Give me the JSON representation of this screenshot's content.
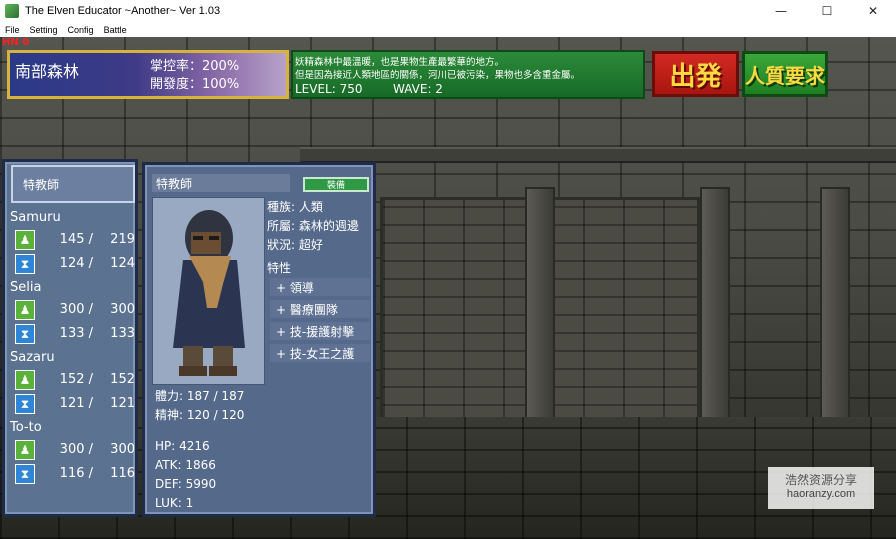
{
  "window": {
    "title": "The Elven Educator ~Another~ Ver 1.03",
    "minimize": "—",
    "maximize": "☐",
    "close": "✕"
  },
  "menu": [
    "File",
    "Setting",
    "Config",
    "Battle"
  ],
  "hud": {
    "corner_text": "HN 0"
  },
  "area": {
    "name": "南部森林",
    "control_label": "掌控率：200%",
    "development_label": "開發度：100%"
  },
  "description": {
    "line1": "妖精森林中最溫暖，也是果物生產最繁華的地方。",
    "line2": "但是因為接近人類地區的關係，河川已被污染，果物也多含重金屬。",
    "level": "LEVEL: 750",
    "wave": "WAVE: 2"
  },
  "buttons": {
    "depart": "出発",
    "hostage_request": "人質要求",
    "equip": "裝備"
  },
  "party": {
    "tab_label": "特教師",
    "members": [
      {
        "name": "Samuru",
        "hp": "145 /",
        "hp_max": "219",
        "mp": "124 /",
        "mp_max": "124"
      },
      {
        "name": "Selia",
        "hp": "300 /",
        "hp_max": "300",
        "mp": "133 /",
        "mp_max": "133"
      },
      {
        "name": "Sazaru",
        "hp": "152 /",
        "hp_max": "152",
        "mp": "121 /",
        "mp_max": "121"
      },
      {
        "name": "To-to",
        "hp": "300 /",
        "hp_max": "300",
        "mp": "116 /",
        "mp_max": "116"
      }
    ]
  },
  "detail": {
    "name": "特教師",
    "race": "種族: 人類",
    "affiliation": "所屬: 森林的週邊",
    "status": "狀況: 超好",
    "traits_label": "特性",
    "traits": [
      "+ 領導",
      "+ 醫療團隊",
      "+ 技-援護射擊",
      "+ 技-女王之護"
    ],
    "stamina": "體力: 187 / 187",
    "spirit": "精神: 120 / 120",
    "hp": "HP: 4216",
    "atk": "ATK: 1866",
    "def": "DEF: 5990",
    "luk": "LUK: 1"
  },
  "watermark": {
    "cn": "浩然资源分享",
    "url": "haoranzy.com"
  },
  "colors": {
    "accent_gold": "#d6b33c",
    "depart_red": "#d22a22",
    "request_green": "#3aa83a",
    "panel_blue": "#5c7291"
  }
}
